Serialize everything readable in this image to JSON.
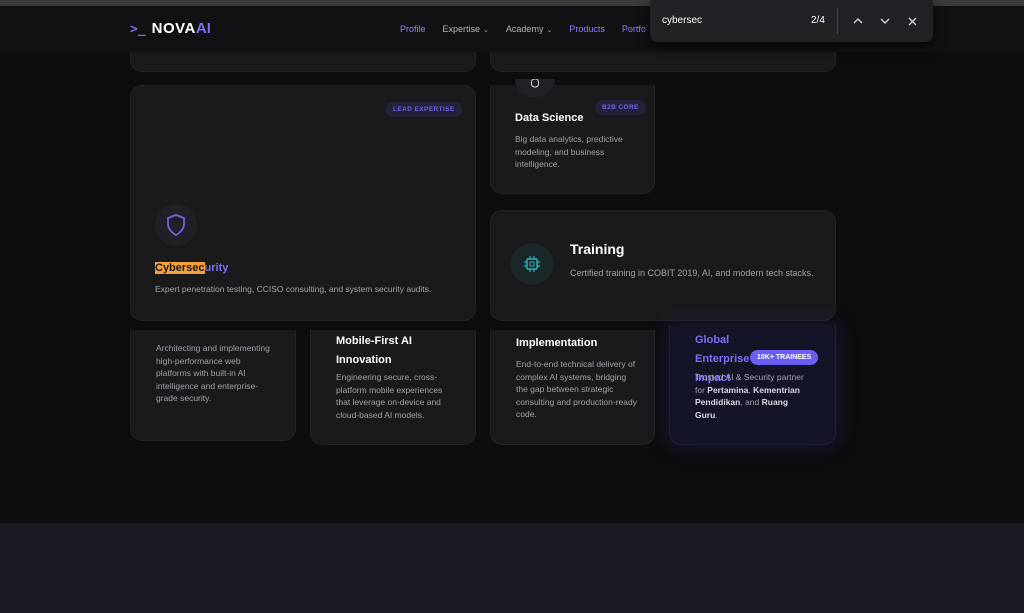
{
  "logo": {
    "mark": ">_",
    "part1": "NOVA",
    "part2": "AI"
  },
  "nav": {
    "items": [
      {
        "label": "Profile"
      },
      {
        "label": "Expertise"
      },
      {
        "label": "Academy"
      },
      {
        "label": "Products"
      },
      {
        "label": "Portfo"
      }
    ]
  },
  "find_bar": {
    "query": "cybersec",
    "count": "2/4"
  },
  "cards": {
    "cyber": {
      "badge": "LEAD EXPERTISE",
      "title_highlight": "Cybersec",
      "title_rest": "urity",
      "desc": "Expert penetration testing, CCISO consulting, and system security audits."
    },
    "data_science": {
      "badge": "B2B CORE",
      "title": "Data Science",
      "desc": "Big data analytics, predictive modeling, and business intelligence."
    },
    "training": {
      "title": "Training",
      "desc": "Certified training in COBIT 2019, AI, and modern tech stacks."
    },
    "web": {
      "desc": "Architecting and implementing high-performance web platforms with built-in AI intelligence and enterprise-grade security."
    },
    "mobile": {
      "title": "Mobile-First AI Innovation",
      "desc": "Engineering secure, cross-platform mobile experiences that leverage on-device and cloud-based AI models."
    },
    "implementation": {
      "title": "Implementation",
      "desc": "End-to-end technical delivery of complex AI systems, bridging the gap between strategic consulting and production-ready code."
    },
    "enterprise": {
      "title": "Global Enterprise Impact",
      "badge": "10K+ TRAINEES",
      "desc_prefix": "Trusted AI & Security partner for ",
      "client1": "Pertamina",
      "sep1": ", ",
      "client2": "Kementrian Pendidikan",
      "sep2": ", and ",
      "client3": "Ruang Guru",
      "end": "."
    }
  },
  "colors": {
    "accent": "#7b6ef6",
    "highlight": "#f5a03a",
    "teal": "#2fb3b3"
  }
}
